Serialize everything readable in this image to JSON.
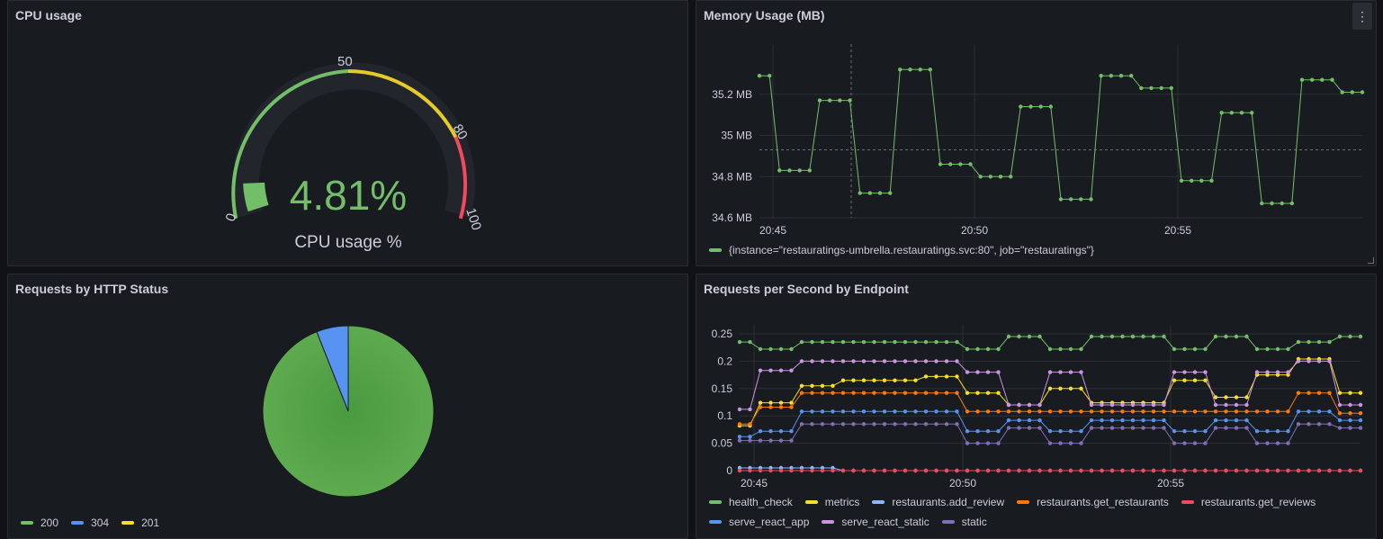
{
  "colors": {
    "green": "#73bf69",
    "yellow": "#fade2a",
    "blue": "#5794f2",
    "orange": "#ff780a",
    "red": "#f2495c",
    "purple": "#ca95e5",
    "lightblue": "#8ab8ff",
    "violet": "#806eb7"
  },
  "cpu_panel": {
    "title": "CPU usage",
    "value": "4.81%",
    "label": "CPU usage %",
    "value_fraction": 0.0481,
    "thresholds": [
      "0",
      "50",
      "80",
      "100"
    ]
  },
  "memory_panel": {
    "title": "Memory Usage (MB)",
    "menu_icon": "kebab-menu-icon",
    "legend": "{instance=\"restauratings-umbrella.restauratings.svc:80\", job=\"restauratings\"}"
  },
  "status_panel": {
    "title": "Requests by HTTP Status",
    "legend": [
      {
        "label": "200",
        "color": "#73bf69"
      },
      {
        "label": "304",
        "color": "#5794f2"
      },
      {
        "label": "201",
        "color": "#fade2a"
      }
    ]
  },
  "rps_panel": {
    "title": "Requests per Second by Endpoint",
    "legend": [
      {
        "label": "health_check",
        "color": "#73bf69"
      },
      {
        "label": "metrics",
        "color": "#fade2a"
      },
      {
        "label": "restaurants.add_review",
        "color": "#8ab8ff"
      },
      {
        "label": "restaurants.get_restaurants",
        "color": "#ff780a"
      },
      {
        "label": "restaurants.get_reviews",
        "color": "#f2495c"
      },
      {
        "label": "serve_react_app",
        "color": "#5794f2"
      },
      {
        "label": "serve_react_static",
        "color": "#ca95e5"
      },
      {
        "label": "static",
        "color": "#806eb7"
      }
    ]
  },
  "chart_data": [
    {
      "type": "line",
      "title": "Memory Usage (MB)",
      "x_ticks": [
        "20:45",
        "20:50",
        "20:55"
      ],
      "y_ticks": [
        "34.6 MB",
        "34.8 MB",
        "35 MB",
        "35.2 MB"
      ],
      "ylim": [
        34.6,
        35.4
      ],
      "series": [
        {
          "name": "{instance=\"restauratings-umbrella.restauratings.svc:80\", job=\"restauratings\"}",
          "values": [
            35.29,
            35.29,
            34.83,
            34.83,
            34.83,
            34.83,
            35.17,
            35.17,
            35.17,
            35.17,
            34.72,
            34.72,
            34.72,
            34.72,
            35.32,
            35.32,
            35.32,
            35.32,
            34.86,
            34.86,
            34.86,
            34.86,
            34.8,
            34.8,
            34.8,
            34.8,
            35.14,
            35.14,
            35.14,
            35.14,
            34.69,
            34.69,
            34.69,
            34.69,
            35.29,
            35.29,
            35.29,
            35.29,
            35.23,
            35.23,
            35.23,
            35.23,
            34.78,
            34.78,
            34.78,
            34.78,
            35.11,
            35.11,
            35.11,
            35.11,
            34.67,
            34.67,
            34.67,
            34.67,
            35.27,
            35.27,
            35.27,
            35.27,
            35.21,
            35.21,
            35.21
          ]
        }
      ]
    },
    {
      "type": "gauge",
      "title": "CPU usage",
      "value": 4.81,
      "unit": "%",
      "min": 0,
      "max": 100,
      "thresholds": [
        0,
        50,
        80,
        100
      ]
    },
    {
      "type": "pie",
      "title": "Requests by HTTP Status",
      "categories": [
        "200",
        "304",
        "201"
      ],
      "values": [
        94,
        6,
        0
      ]
    },
    {
      "type": "line",
      "title": "Requests per Second by Endpoint",
      "x_ticks": [
        "20:45",
        "20:50",
        "20:55"
      ],
      "y_ticks": [
        "0",
        "0.05",
        "0.1",
        "0.15",
        "0.2",
        "0.25"
      ],
      "ylim": [
        0,
        0.25
      ],
      "series": [
        {
          "name": "health_check",
          "values": [
            0.235,
            0.235,
            0.222,
            0.222,
            0.222,
            0.222,
            0.235,
            0.235,
            0.235,
            0.235,
            0.235,
            0.235,
            0.235,
            0.235,
            0.235,
            0.235,
            0.235,
            0.235,
            0.235,
            0.235,
            0.235,
            0.235,
            0.222,
            0.222,
            0.222,
            0.222,
            0.245,
            0.245,
            0.245,
            0.245,
            0.222,
            0.222,
            0.222,
            0.222,
            0.245,
            0.245,
            0.245,
            0.245,
            0.245,
            0.245,
            0.245,
            0.245,
            0.222,
            0.222,
            0.222,
            0.222,
            0.245,
            0.245,
            0.245,
            0.245,
            0.222,
            0.222,
            0.222,
            0.222,
            0.235,
            0.235,
            0.235,
            0.235,
            0.245,
            0.245,
            0.245
          ]
        },
        {
          "name": "metrics",
          "values": [
            0.082,
            0.082,
            0.124,
            0.124,
            0.124,
            0.124,
            0.155,
            0.155,
            0.155,
            0.155,
            0.165,
            0.165,
            0.165,
            0.165,
            0.165,
            0.165,
            0.165,
            0.165,
            0.172,
            0.172,
            0.172,
            0.172,
            0.142,
            0.142,
            0.142,
            0.142,
            0.12,
            0.12,
            0.12,
            0.12,
            0.15,
            0.15,
            0.15,
            0.15,
            0.124,
            0.124,
            0.124,
            0.124,
            0.124,
            0.124,
            0.124,
            0.124,
            0.165,
            0.165,
            0.165,
            0.165,
            0.134,
            0.134,
            0.134,
            0.134,
            0.175,
            0.175,
            0.175,
            0.175,
            0.204,
            0.204,
            0.204,
            0.204,
            0.142,
            0.142,
            0.142
          ]
        },
        {
          "name": "restaurants.add_review",
          "values": [
            0.005,
            0.005,
            0.005,
            0.005,
            0.005,
            0.005,
            0.005,
            0.005,
            0.005,
            0.005,
            0,
            0,
            0,
            0,
            0,
            0,
            0,
            0,
            0,
            0,
            0,
            0,
            0,
            0,
            0,
            0,
            0,
            0,
            0,
            0,
            0,
            0,
            0,
            0,
            0,
            0,
            0,
            0,
            0,
            0,
            0,
            0,
            0,
            0,
            0,
            0,
            0,
            0,
            0,
            0,
            0,
            0,
            0,
            0,
            0,
            0,
            0,
            0,
            0,
            0,
            0
          ]
        },
        {
          "name": "restaurants.get_restaurants",
          "values": [
            0.085,
            0.085,
            0.116,
            0.116,
            0.116,
            0.116,
            0.142,
            0.142,
            0.142,
            0.142,
            0.142,
            0.142,
            0.142,
            0.142,
            0.142,
            0.142,
            0.142,
            0.142,
            0.142,
            0.142,
            0.142,
            0.142,
            0.108,
            0.108,
            0.108,
            0.108,
            0.108,
            0.108,
            0.108,
            0.108,
            0.108,
            0.108,
            0.108,
            0.108,
            0.108,
            0.108,
            0.108,
            0.108,
            0.108,
            0.108,
            0.108,
            0.108,
            0.108,
            0.108,
            0.108,
            0.108,
            0.108,
            0.108,
            0.108,
            0.108,
            0.108,
            0.108,
            0.108,
            0.108,
            0.142,
            0.142,
            0.142,
            0.142,
            0.105,
            0.105,
            0.105
          ]
        },
        {
          "name": "restaurants.get_reviews",
          "values": [
            0,
            0,
            0,
            0,
            0,
            0,
            0,
            0,
            0,
            0,
            0,
            0,
            0,
            0,
            0,
            0,
            0,
            0,
            0,
            0,
            0,
            0,
            0,
            0,
            0,
            0,
            0,
            0,
            0,
            0,
            0,
            0,
            0,
            0,
            0,
            0,
            0,
            0,
            0,
            0,
            0,
            0,
            0,
            0,
            0,
            0,
            0,
            0,
            0,
            0,
            0,
            0,
            0,
            0,
            0,
            0,
            0,
            0,
            0,
            0,
            0
          ]
        },
        {
          "name": "serve_react_app",
          "values": [
            0.062,
            0.062,
            0.072,
            0.072,
            0.072,
            0.072,
            0.108,
            0.108,
            0.108,
            0.108,
            0.108,
            0.108,
            0.108,
            0.108,
            0.108,
            0.108,
            0.108,
            0.108,
            0.108,
            0.108,
            0.108,
            0.108,
            0.072,
            0.072,
            0.072,
            0.072,
            0.092,
            0.092,
            0.092,
            0.092,
            0.072,
            0.072,
            0.072,
            0.072,
            0.092,
            0.092,
            0.092,
            0.092,
            0.092,
            0.092,
            0.092,
            0.092,
            0.072,
            0.072,
            0.072,
            0.072,
            0.092,
            0.092,
            0.092,
            0.092,
            0.072,
            0.072,
            0.072,
            0.072,
            0.108,
            0.108,
            0.108,
            0.108,
            0.092,
            0.092,
            0.092
          ]
        },
        {
          "name": "serve_react_static",
          "values": [
            0.112,
            0.112,
            0.183,
            0.183,
            0.183,
            0.183,
            0.2,
            0.2,
            0.2,
            0.2,
            0.2,
            0.2,
            0.2,
            0.2,
            0.2,
            0.2,
            0.2,
            0.2,
            0.2,
            0.2,
            0.2,
            0.2,
            0.18,
            0.18,
            0.18,
            0.18,
            0.12,
            0.12,
            0.12,
            0.12,
            0.18,
            0.18,
            0.18,
            0.18,
            0.12,
            0.12,
            0.12,
            0.12,
            0.12,
            0.12,
            0.12,
            0.12,
            0.18,
            0.18,
            0.18,
            0.18,
            0.12,
            0.12,
            0.12,
            0.12,
            0.18,
            0.18,
            0.18,
            0.18,
            0.2,
            0.2,
            0.2,
            0.2,
            0.12,
            0.12,
            0.12
          ]
        },
        {
          "name": "static",
          "values": [
            0.055,
            0.055,
            0.055,
            0.055,
            0.055,
            0.055,
            0.085,
            0.085,
            0.085,
            0.085,
            0.085,
            0.085,
            0.085,
            0.085,
            0.085,
            0.085,
            0.085,
            0.085,
            0.085,
            0.085,
            0.085,
            0.085,
            0.05,
            0.05,
            0.05,
            0.05,
            0.078,
            0.078,
            0.078,
            0.078,
            0.05,
            0.05,
            0.05,
            0.05,
            0.078,
            0.078,
            0.078,
            0.078,
            0.078,
            0.078,
            0.078,
            0.078,
            0.05,
            0.05,
            0.05,
            0.05,
            0.078,
            0.078,
            0.078,
            0.078,
            0.05,
            0.05,
            0.05,
            0.05,
            0.085,
            0.085,
            0.085,
            0.085,
            0.078,
            0.078,
            0.078
          ]
        }
      ]
    }
  ]
}
